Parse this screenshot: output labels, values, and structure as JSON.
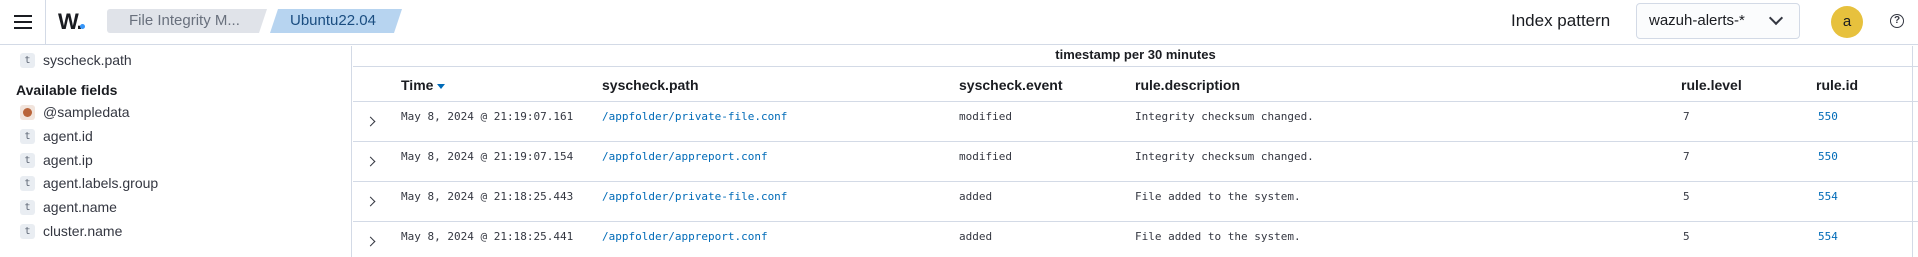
{
  "header": {
    "logo_text": "W.",
    "breadcrumbs": [
      {
        "label": "File Integrity M..."
      },
      {
        "label": "Ubuntu22.04"
      }
    ],
    "index_pattern_label": "Index pattern",
    "index_pattern_value": "wazuh-alerts-*",
    "avatar_initial": "a",
    "help_symbol": "?"
  },
  "sidebar": {
    "selected_fields": [
      {
        "type": "t",
        "name": "syscheck.path"
      }
    ],
    "available_title": "Available fields",
    "available_fields": [
      {
        "type": "geo",
        "name": "@sampledata"
      },
      {
        "type": "t",
        "name": "agent.id"
      },
      {
        "type": "t",
        "name": "agent.ip"
      },
      {
        "type": "t",
        "name": "agent.labels.group"
      },
      {
        "type": "t",
        "name": "agent.name"
      },
      {
        "type": "t",
        "name": "cluster.name"
      }
    ]
  },
  "main": {
    "chart_title": "timestamp per 30 minutes",
    "columns": [
      "Time",
      "syscheck.path",
      "syscheck.event",
      "rule.description",
      "rule.level",
      "rule.id"
    ],
    "rows": [
      {
        "time": "May 8, 2024 @ 21:19:07.161",
        "path": "/appfolder/private-file.conf",
        "event": "modified",
        "description": "Integrity checksum changed.",
        "level": "7",
        "rule_id": "550"
      },
      {
        "time": "May 8, 2024 @ 21:19:07.154",
        "path": "/appfolder/appreport.conf",
        "event": "modified",
        "description": "Integrity checksum changed.",
        "level": "7",
        "rule_id": "550"
      },
      {
        "time": "May 8, 2024 @ 21:18:25.443",
        "path": "/appfolder/private-file.conf",
        "event": "added",
        "description": "File added to the system.",
        "level": "5",
        "rule_id": "554"
      },
      {
        "time": "May 8, 2024 @ 21:18:25.441",
        "path": "/appfolder/appreport.conf",
        "event": "added",
        "description": "File added to the system.",
        "level": "5",
        "rule_id": "554"
      }
    ]
  },
  "colors": {
    "accent": "#006bb8",
    "avatar_bg": "#e7c13d",
    "breadcrumb_active": "#b7d4f0"
  }
}
